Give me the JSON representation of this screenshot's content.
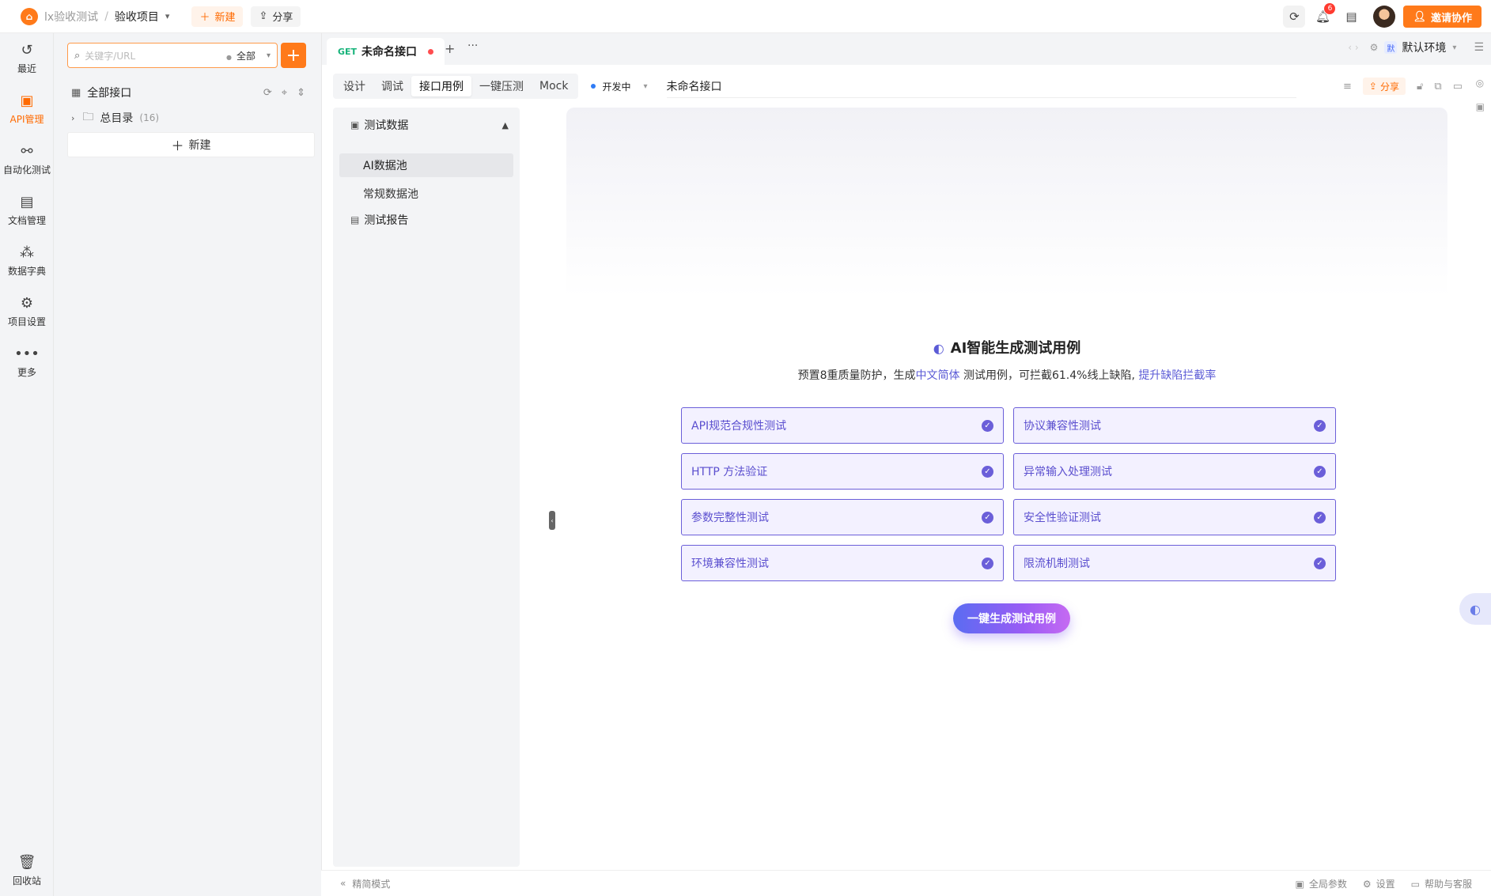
{
  "topbar": {
    "team": "lx验收测试",
    "project": "验收项目",
    "new_label": "新建",
    "share_label": "分享",
    "notification_count": "6",
    "invite_label": "邀请协作"
  },
  "leftnav": {
    "items": [
      {
        "label": "最近",
        "icon": "clock-icon"
      },
      {
        "label": "API管理",
        "icon": "api-icon"
      },
      {
        "label": "自动化测试",
        "icon": "automation-icon"
      },
      {
        "label": "文档管理",
        "icon": "document-icon"
      },
      {
        "label": "数据字典",
        "icon": "dictionary-icon"
      },
      {
        "label": "项目设置",
        "icon": "settings-icon"
      },
      {
        "label": "更多",
        "icon": "more-icon"
      }
    ],
    "trash_label": "回收站"
  },
  "tree": {
    "search_placeholder": "关键字/URL",
    "filter_value": "全部",
    "all_label": "全部接口",
    "root_folder": "总目录",
    "root_count": "(16)",
    "new_label": "新建"
  },
  "tabs": {
    "method": "GET",
    "name": "未命名接口",
    "env_badge": "默",
    "env_label": "默认环境"
  },
  "subtabs": {
    "items": [
      "设计",
      "调试",
      "接口用例",
      "一键压测",
      "Mock"
    ],
    "active_index": 2,
    "status": "开发中",
    "api_name": "未命名接口",
    "share_label": "分享"
  },
  "casenav": {
    "group1": "测试数据",
    "item1": "AI数据池",
    "item2": "常规数据池",
    "group2": "测试报告"
  },
  "ai": {
    "title": "AI智能生成测试用例",
    "sub_prefix": "预置8重质量防护，生成",
    "sub_lang": "中文简体",
    "sub_mid": " 测试用例，可拦截61.4%线上缺陷, ",
    "sub_link": "提升缺陷拦截率",
    "cards": [
      "API规范合规性测试",
      "协议兼容性测试",
      "HTTP 方法验证",
      "异常输入处理测试",
      "参数完整性测试",
      "安全性验证测试",
      "环境兼容性测试",
      "限流机制测试"
    ],
    "generate_label": "一键生成测试用例"
  },
  "footer": {
    "mode": "精简模式",
    "global_params": "全局参数",
    "settings": "设置",
    "help": "帮助与客服"
  },
  "colors": {
    "brand": "#ff7a1a",
    "ai_accent": "#6b5fd9",
    "get_method": "#16b37a"
  }
}
